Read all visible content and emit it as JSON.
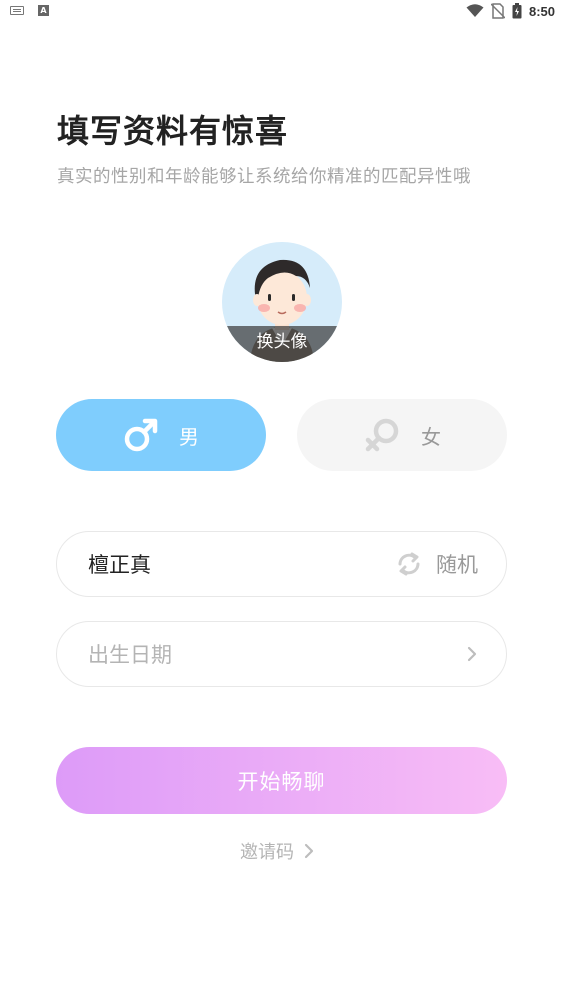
{
  "status_bar": {
    "time": "8:50",
    "icons": [
      "keyboard-icon",
      "a-icon",
      "wifi-icon",
      "no-sim-icon",
      "battery-icon"
    ]
  },
  "header": {
    "title": "填写资料有惊喜",
    "subtitle": "真实的性别和年龄能够让系统给你精准的匹配异性哦"
  },
  "avatar": {
    "change_label": "换头像"
  },
  "gender": {
    "male_label": "男",
    "female_label": "女",
    "selected": "male",
    "colors": {
      "male_active": "#7fcdfd",
      "inactive_bg": "#f5f5f5"
    }
  },
  "form": {
    "nickname_value": "檀正真",
    "random_label": "随机",
    "birthdate_placeholder": "出生日期"
  },
  "actions": {
    "start_label": "开始畅聊",
    "invite_label": "邀请码",
    "start_gradient": [
      "#dd9bf8",
      "#f8bdf6"
    ]
  }
}
